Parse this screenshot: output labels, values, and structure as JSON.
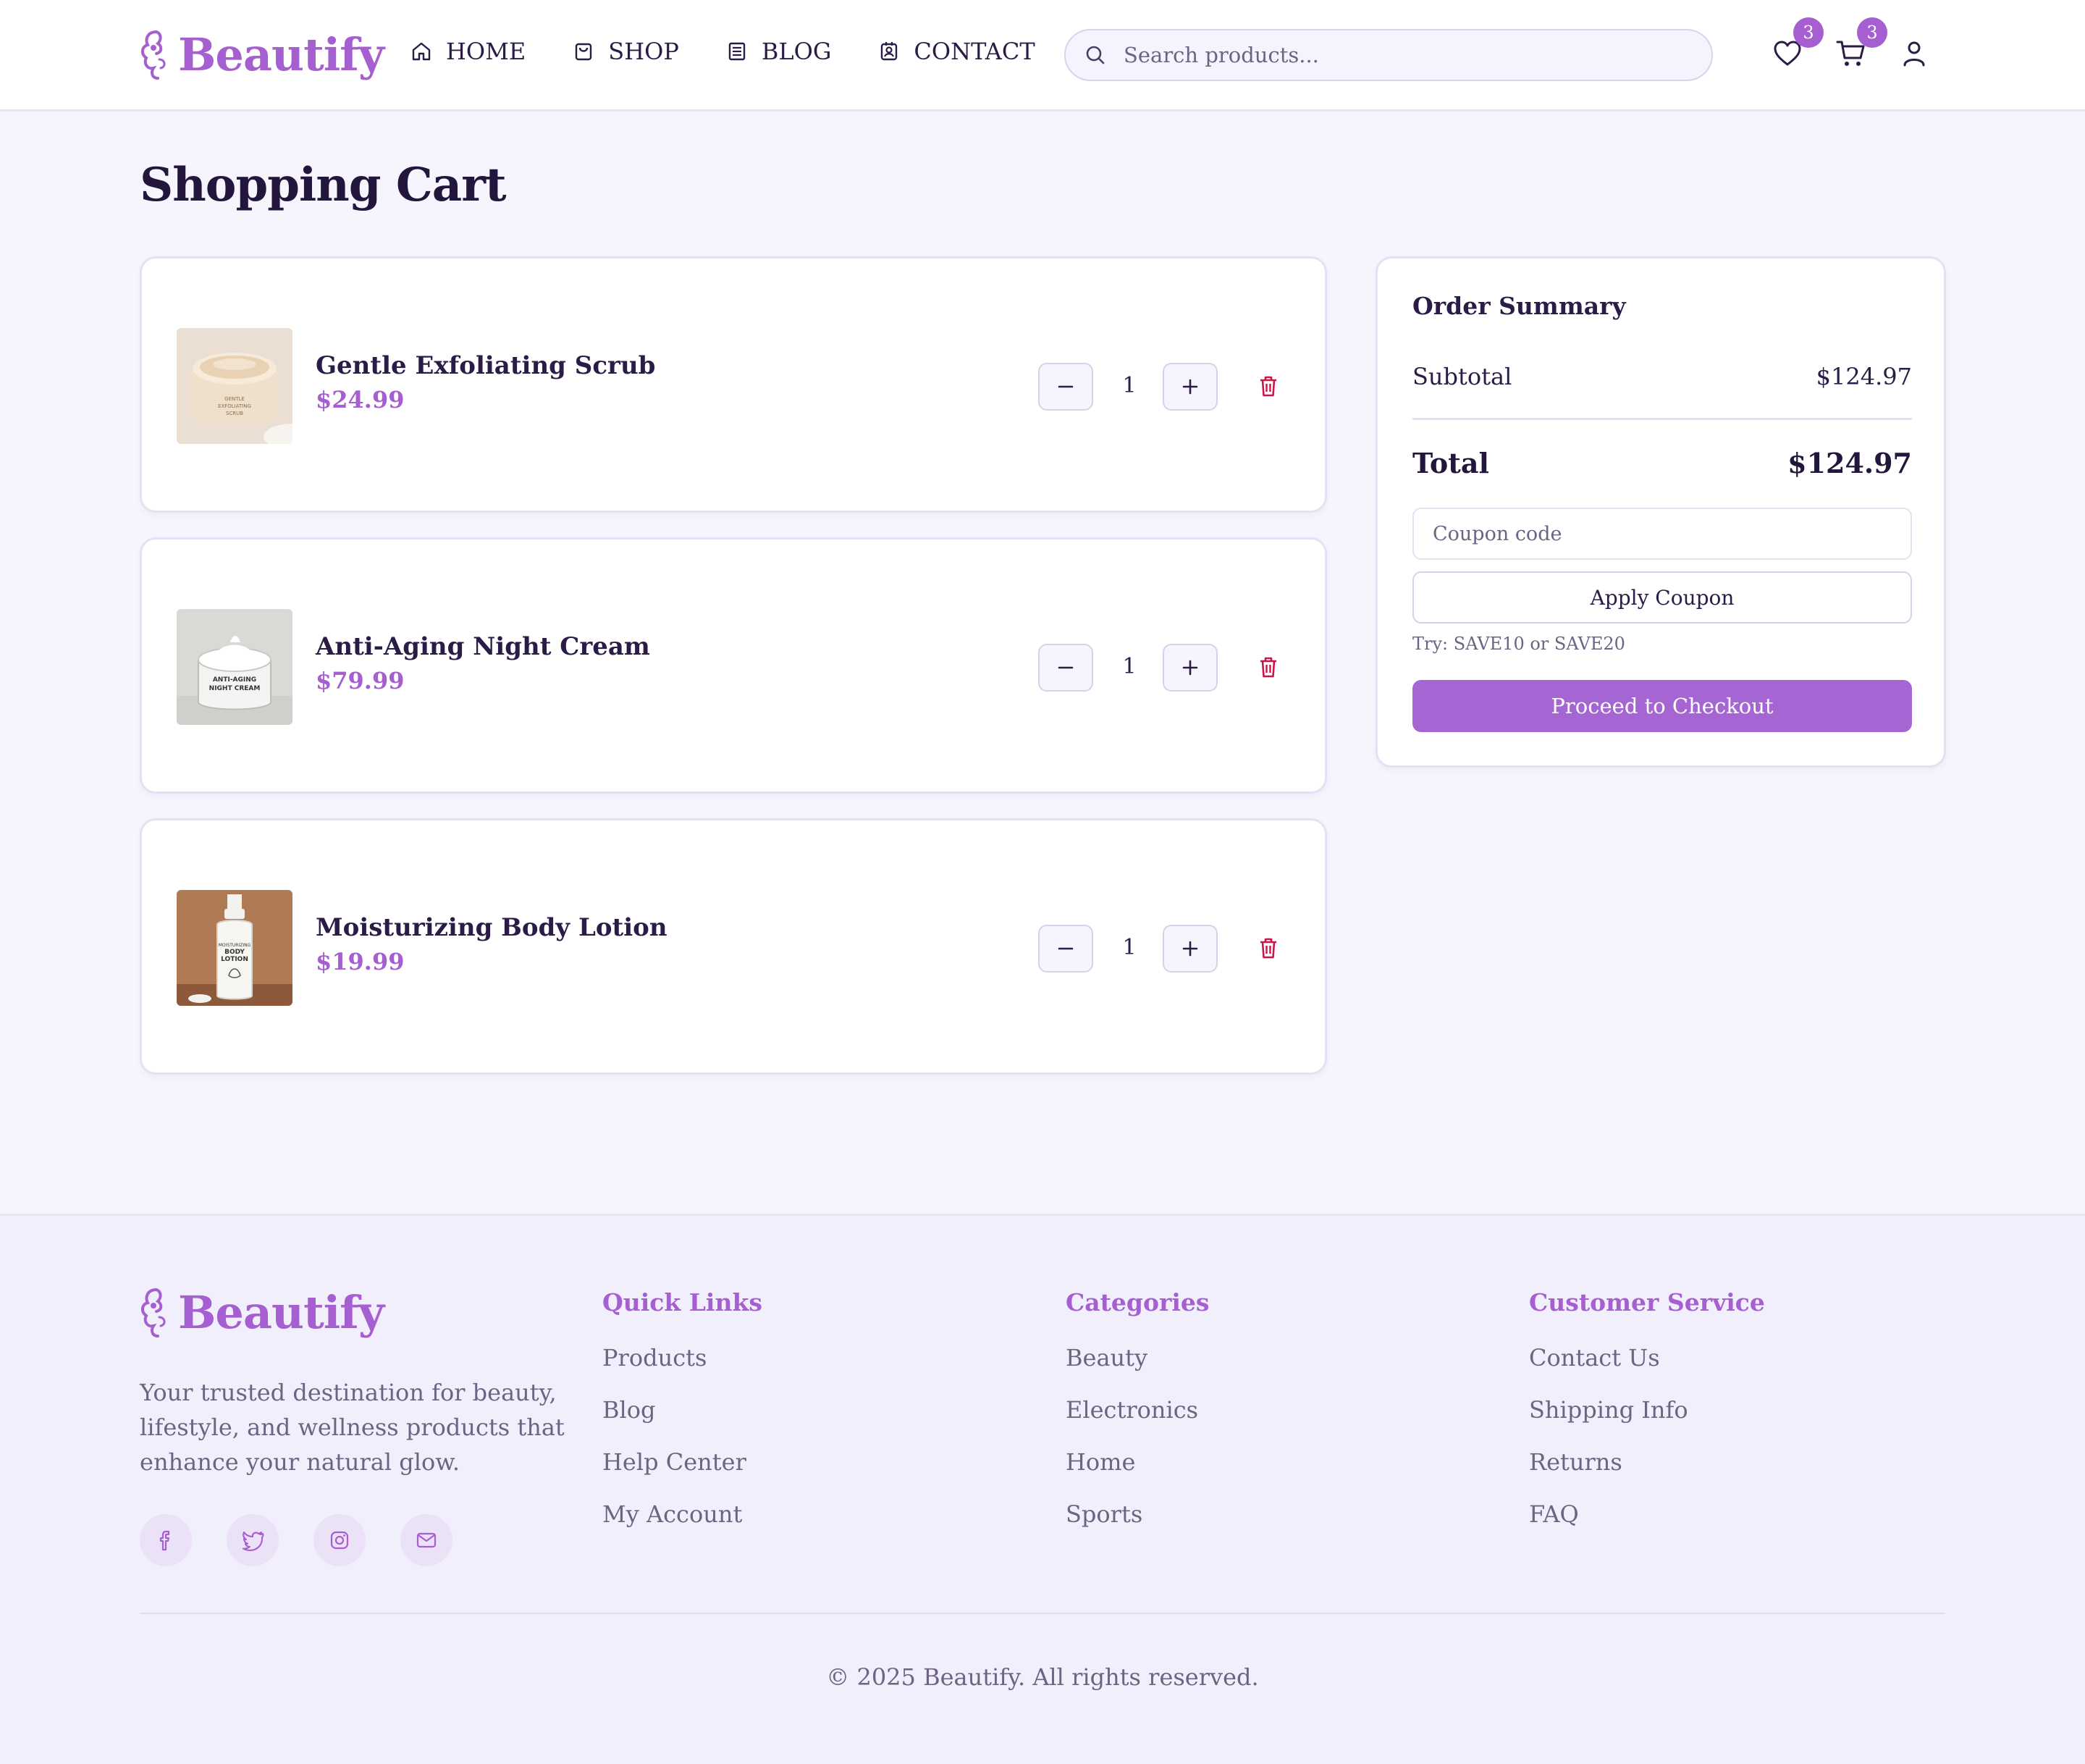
{
  "brand": {
    "name": "Beautify",
    "accent": "#a65fd0"
  },
  "nav": [
    {
      "label": "HOME",
      "icon": "home-icon"
    },
    {
      "label": "SHOP",
      "icon": "shopping-bag-icon"
    },
    {
      "label": "BLOG",
      "icon": "newspaper-icon"
    },
    {
      "label": "CONTACT",
      "icon": "contact-card-icon"
    }
  ],
  "search": {
    "placeholder": "Search products..."
  },
  "header_icons": {
    "wishlist_count": "3",
    "cart_count": "3"
  },
  "page_title": "Shopping Cart",
  "cart": {
    "items": [
      {
        "name": "Gentle Exfoliating Scrub",
        "price": "$24.99",
        "quantity": "1",
        "image": "scrub-jar"
      },
      {
        "name": "Anti-Aging Night Cream",
        "price": "$79.99",
        "quantity": "1",
        "image": "night-cream-jar"
      },
      {
        "name": "Moisturizing Body Lotion",
        "price": "$19.99",
        "quantity": "1",
        "image": "lotion-bottle"
      }
    ]
  },
  "summary": {
    "title": "Order Summary",
    "subtotal_label": "Subtotal",
    "subtotal_value": "$124.97",
    "total_label": "Total",
    "total_value": "$124.97",
    "coupon_placeholder": "Coupon code",
    "apply_label": "Apply Coupon",
    "hint": "Try: SAVE10 or SAVE20",
    "checkout_label": "Proceed to Checkout"
  },
  "footer": {
    "description": "Your trusted destination for beauty, lifestyle, and wellness products that enhance your natural glow.",
    "socials": [
      "facebook-icon",
      "twitter-icon",
      "instagram-icon",
      "mail-icon"
    ],
    "columns": [
      {
        "title": "Quick Links",
        "links": [
          "Products",
          "Blog",
          "Help Center",
          "My Account"
        ]
      },
      {
        "title": "Categories",
        "links": [
          "Beauty",
          "Electronics",
          "Home",
          "Sports"
        ]
      },
      {
        "title": "Customer Service",
        "links": [
          "Contact Us",
          "Shipping Info",
          "Returns",
          "FAQ"
        ]
      }
    ],
    "copyright": "© 2025 Beautify. All rights reserved."
  }
}
